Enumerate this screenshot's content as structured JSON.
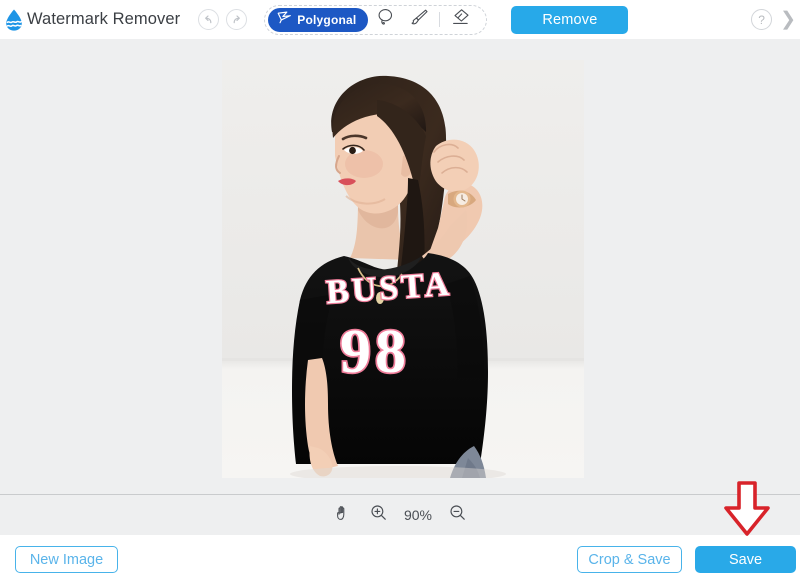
{
  "app": {
    "title": "Watermark Remover",
    "logo_icon": "water-drop-logo"
  },
  "header": {
    "undo_icon": "undo-arrow-icon",
    "redo_icon": "redo-arrow-icon",
    "tools": [
      {
        "id": "polygonal",
        "label": "Polygonal",
        "icon": "polygonal-lasso-icon",
        "active": true
      },
      {
        "id": "lasso",
        "label": "Lasso",
        "icon": "lasso-icon",
        "active": false
      },
      {
        "id": "brush",
        "label": "Brush",
        "icon": "brush-icon",
        "active": false
      },
      {
        "id": "eraser",
        "label": "Eraser",
        "icon": "eraser-icon",
        "active": false
      }
    ],
    "remove_label": "Remove",
    "help_label": "?",
    "help_icon": "question-mark-icon",
    "next_icon": "chevron-right-icon"
  },
  "canvas": {
    "image_alt": "Woman in black BUSTA 98 t-shirt with hand in hair",
    "shirt_text_top": "BUSTA",
    "shirt_text_number": "98"
  },
  "zoombar": {
    "hand_icon": "hand-tool-icon",
    "zoom_in_icon": "zoom-in-icon",
    "zoom_out_icon": "zoom-out-icon",
    "zoom_level": "90%"
  },
  "footer": {
    "new_image_label": "New Image",
    "crop_save_label": "Crop & Save",
    "save_label": "Save"
  },
  "annotation": {
    "arrow_icon": "red-down-arrow-icon",
    "arrow_color": "#d8232a",
    "points_to": "Save"
  },
  "colors": {
    "accent_blue": "#29a9e8",
    "tool_active_blue": "#1d58c4",
    "outline_blue": "#48b3ea",
    "canvas_bg": "#eeeff0",
    "header_bg": "#ffffff",
    "annotation_red": "#d8232a"
  }
}
